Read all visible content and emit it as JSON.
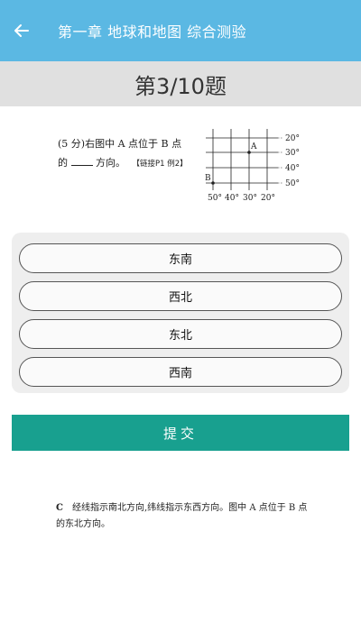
{
  "appbar": {
    "title": "第一章 地球和地图  综合测验",
    "back_icon": "arrow-left-icon"
  },
  "question_bar": {
    "label": "第3/10题"
  },
  "question": {
    "score": "(5 分)",
    "text_part1": "右图中 A 点位于 B 点",
    "text_part2_before": "的",
    "text_part2_after": "方向。",
    "link": "【链接P1 例2】",
    "figure": {
      "point_a": "A",
      "point_b": "B",
      "lat_labels": [
        "20°",
        "30°",
        "40°",
        "50°"
      ],
      "lon_labels": [
        "50°",
        "40°",
        "30°",
        "20°"
      ]
    }
  },
  "options": [
    {
      "label": "东南"
    },
    {
      "label": "西北"
    },
    {
      "label": "东北"
    },
    {
      "label": "西南"
    }
  ],
  "submit": {
    "label": "提交"
  },
  "analysis": {
    "answer": "C",
    "text": "经线指示南北方向,纬线指示东西方向。图中 A 点位于 B 点的东北方向。"
  }
}
